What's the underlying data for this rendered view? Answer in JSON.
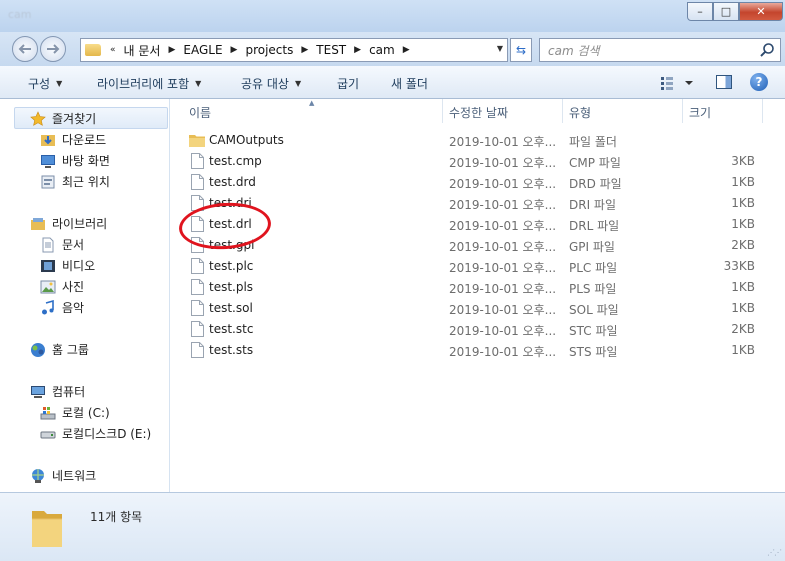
{
  "window": {
    "title": "cam",
    "minimize_glyph": "–",
    "maximize_glyph": "□",
    "close_glyph": "✕"
  },
  "address": {
    "prefix": "«",
    "crumbs": [
      "내 문서",
      "EAGLE",
      "projects",
      "TEST",
      "cam"
    ],
    "refresh_glyph": "⇆"
  },
  "search": {
    "placeholder": "cam 검색"
  },
  "toolbar": {
    "organize": "구성",
    "include_in_library": "라이브러리에 포함",
    "share_with": "공유 대상",
    "burn": "굽기",
    "new_folder": "새 폴더",
    "help_glyph": "?"
  },
  "nav": {
    "favorites": "즐겨찾기",
    "downloads": "다운로드",
    "desktop": "바탕 화면",
    "recent": "최근 위치",
    "libraries": "라이브러리",
    "documents": "문서",
    "videos": "비디오",
    "pictures": "사진",
    "music": "음악",
    "homegroup": "홈 그룹",
    "computer": "컴퓨터",
    "local_disk": "로컬 (C:)",
    "local_disk_d": "로컬디스크D (E:)",
    "network": "네트워크"
  },
  "columns": {
    "name": "이름",
    "modified": "수정한 날짜",
    "type": "유형",
    "size": "크기"
  },
  "files": [
    {
      "name": "CAMOutputs",
      "date": "2019-10-01 오후...",
      "type": "파일 폴더",
      "size": "",
      "kind": "folder"
    },
    {
      "name": "test.cmp",
      "date": "2019-10-01 오후...",
      "type": "CMP 파일",
      "size": "3KB",
      "kind": "file"
    },
    {
      "name": "test.drd",
      "date": "2019-10-01 오후...",
      "type": "DRD 파일",
      "size": "1KB",
      "kind": "file"
    },
    {
      "name": "test.dri",
      "date": "2019-10-01 오후...",
      "type": "DRI 파일",
      "size": "1KB",
      "kind": "file"
    },
    {
      "name": "test.drl",
      "date": "2019-10-01 오후...",
      "type": "DRL 파일",
      "size": "1KB",
      "kind": "file"
    },
    {
      "name": "test.gpi",
      "date": "2019-10-01 오후...",
      "type": "GPI 파일",
      "size": "2KB",
      "kind": "file"
    },
    {
      "name": "test.plc",
      "date": "2019-10-01 오후...",
      "type": "PLC 파일",
      "size": "33KB",
      "kind": "file"
    },
    {
      "name": "test.pls",
      "date": "2019-10-01 오후...",
      "type": "PLS 파일",
      "size": "1KB",
      "kind": "file"
    },
    {
      "name": "test.sol",
      "date": "2019-10-01 오후...",
      "type": "SOL 파일",
      "size": "1KB",
      "kind": "file"
    },
    {
      "name": "test.stc",
      "date": "2019-10-01 오후...",
      "type": "STC 파일",
      "size": "2KB",
      "kind": "file"
    },
    {
      "name": "test.sts",
      "date": "2019-10-01 오후...",
      "type": "STS 파일",
      "size": "1KB",
      "kind": "file"
    }
  ],
  "details": {
    "item_count": "11개 항목"
  },
  "colors": {
    "annotation_circle": "#e0141e",
    "folder": "#e8bd55",
    "accent": "#1f5fb6"
  }
}
